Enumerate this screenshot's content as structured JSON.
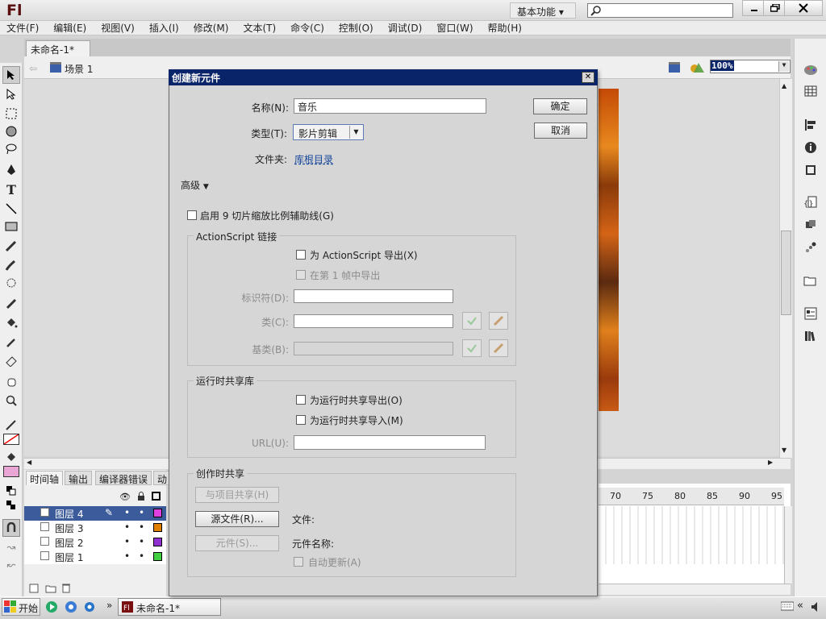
{
  "app": {
    "logo": "Fl",
    "workspace": "基本功能 ▾"
  },
  "menu": [
    "文件(F)",
    "编辑(E)",
    "视图(V)",
    "插入(I)",
    "修改(M)",
    "文本(T)",
    "命令(C)",
    "控制(O)",
    "调试(D)",
    "窗口(W)",
    "帮助(H)"
  ],
  "doc_tab": {
    "title": "未命名-1*",
    "close": "×"
  },
  "editbar": {
    "scene": "场景 1",
    "zoom": "100%"
  },
  "panel_tabs": [
    "时间轴",
    "输出",
    "编译器错误",
    "动"
  ],
  "layers": [
    {
      "name": "图层 4",
      "color": "#e040e0"
    },
    {
      "name": "图层 3",
      "color": "#e08000"
    },
    {
      "name": "图层 2",
      "color": "#9030d0"
    },
    {
      "name": "图层 1",
      "color": "#40d040"
    }
  ],
  "ruler_ticks": [
    "70",
    "75",
    "80",
    "85",
    "90",
    "95"
  ],
  "taskbar": {
    "start": "开始",
    "item": "未命名-1*"
  },
  "dialog": {
    "title": "创建新元件",
    "close": "✕",
    "name_label": "名称(N):",
    "name_value": "音乐",
    "type_label": "类型(T):",
    "type_value": "影片剪辑",
    "folder_label": "文件夹:",
    "folder_value": "库根目录",
    "ok": "确定",
    "cancel": "取消",
    "advanced": "高级",
    "scale9": "启用 9 切片缩放比例辅助线(G)",
    "as_group": "ActionScript 链接",
    "as_export": "为 ActionScript 导出(X)",
    "frame1_export": "在第 1 帧中导出",
    "identifier_label": "标识符(D):",
    "class_label": "类(C):",
    "base_label": "基类(B):",
    "rsl_group": "运行时共享库",
    "rsl_export": "为运行时共享导出(O)",
    "rsl_import": "为运行时共享导入(M)",
    "url_label": "URL(U):",
    "authoring_group": "创作时共享",
    "share_project": "与项目共享(H)",
    "source_file": "源文件(R)...",
    "file_label": "文件:",
    "symbol_btn": "元件(S)...",
    "symbol_name_label": "元件名称:",
    "auto_update": "自动更新(A)"
  }
}
